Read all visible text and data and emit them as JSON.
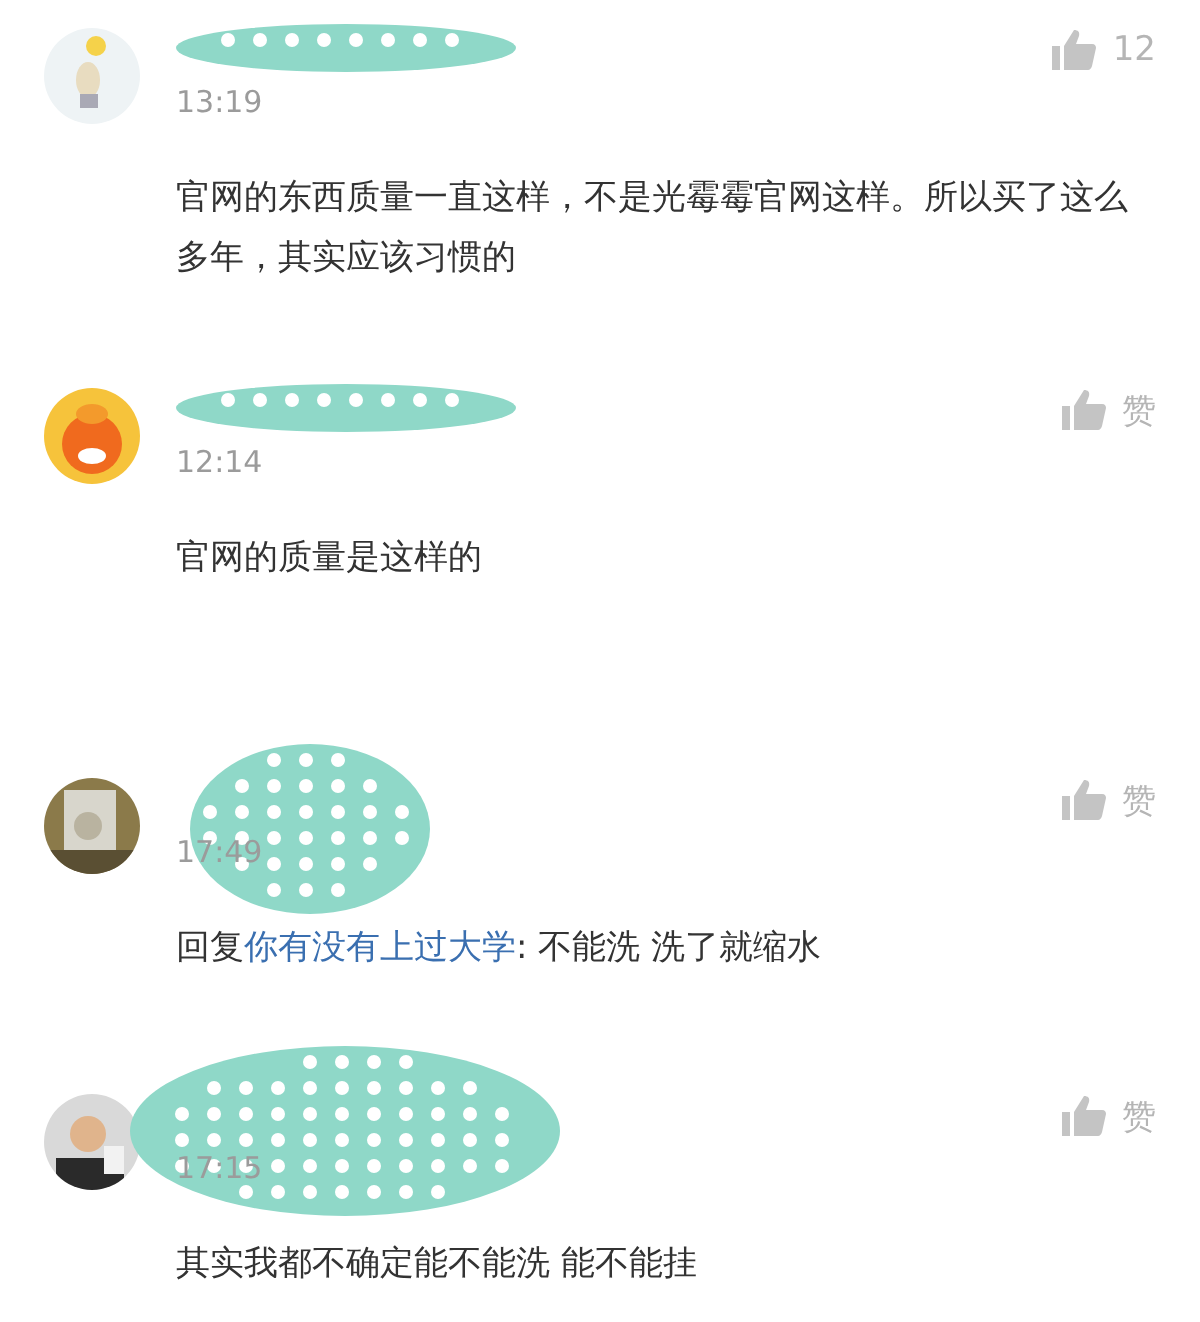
{
  "comments": [
    {
      "time": "13:19",
      "likes": "12",
      "text": "官网的东西质量一直这样，不是光霉霉官网这样。所以买了这么多年，其实应该习惯的"
    },
    {
      "time": "12:14",
      "likes": "赞",
      "text": "官网的质量是这样的"
    },
    {
      "time": "17:49",
      "likes": "赞",
      "reply_prefix": "回复",
      "reply_to": "你有没有上过大学",
      "text": ": 不能洗 洗了就缩水"
    },
    {
      "time": "17:15",
      "likes": "赞",
      "text": "其实我都不确定能不能洗 能不能挂"
    }
  ]
}
